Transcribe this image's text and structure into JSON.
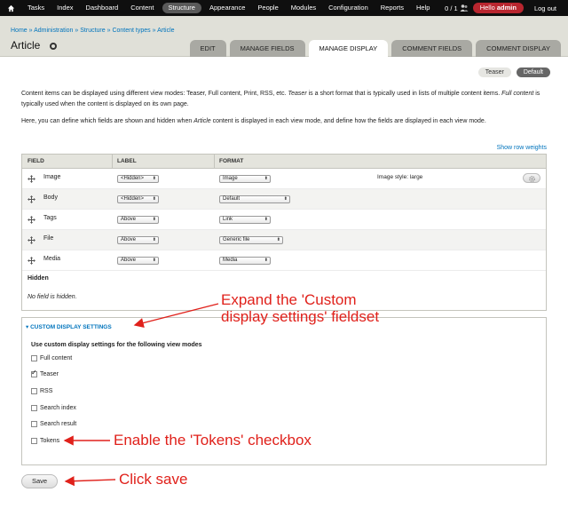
{
  "toolbar": {
    "items": [
      "Tasks",
      "Index",
      "Dashboard",
      "Content",
      "Structure",
      "Appearance",
      "People",
      "Modules",
      "Configuration",
      "Reports",
      "Help"
    ],
    "active": "Structure",
    "count": "0 / 1",
    "hello_prefix": "Hello ",
    "hello_user": "admin",
    "logout": "Log out"
  },
  "header": {
    "breadcrumb": [
      "Home",
      "Administration",
      "Structure",
      "Content types",
      "Article"
    ],
    "breadcrumb_sep": " » ",
    "title": "Article",
    "tabs": [
      "EDIT",
      "MANAGE FIELDS",
      "MANAGE DISPLAY",
      "COMMENT FIELDS",
      "COMMENT DISPLAY"
    ],
    "active_tab": "MANAGE DISPLAY"
  },
  "subtabs": [
    "Teaser",
    "Default"
  ],
  "active_subtab": "Default",
  "description": {
    "p1_a": "Content items can be displayed using different view modes: Teaser, Full content, Print, RSS, etc. ",
    "p1_teaser": "Teaser",
    "p1_b": " is a short format that is typically used in lists of multiple content items. ",
    "p1_full": "Full content",
    "p1_c": " is typically used when the content is displayed on its own page.",
    "p2_a": "Here, you can define which fields are shown and hidden when ",
    "p2_article": "Article",
    "p2_b": " content is displayed in each view mode, and define how the fields are displayed in each view mode."
  },
  "show_row_weights": "Show row weights",
  "table": {
    "headers": [
      "FIELD",
      "LABEL",
      "FORMAT"
    ],
    "rows": [
      {
        "field": "Image",
        "label": "<Hidden>",
        "format": "Image",
        "note": "Image style: large"
      },
      {
        "field": "Body",
        "label": "<Hidden>",
        "format": "Default",
        "note": ""
      },
      {
        "field": "Tags",
        "label": "Above",
        "format": "Link",
        "note": ""
      },
      {
        "field": "File",
        "label": "Above",
        "format": "Generic file",
        "note": ""
      },
      {
        "field": "Media",
        "label": "Above",
        "format": "Media",
        "note": ""
      }
    ],
    "hidden_label": "Hidden",
    "no_hidden": "No field is hidden."
  },
  "custom_settings": {
    "legend": "CUSTOM DISPLAY SETTINGS",
    "title": "Use custom display settings for the following view modes",
    "options": [
      {
        "label": "Full content",
        "checked": false
      },
      {
        "label": "Teaser",
        "checked": true
      },
      {
        "label": "RSS",
        "checked": false
      },
      {
        "label": "Search index",
        "checked": false
      },
      {
        "label": "Search result",
        "checked": false
      },
      {
        "label": "Tokens",
        "checked": false
      }
    ]
  },
  "save_label": "Save",
  "annotations": {
    "expand_1": "Expand the 'Custom",
    "expand_2": "display settings' fieldset",
    "tokens": "Enable the 'Tokens' checkbox",
    "save": "Click save"
  },
  "colors": {
    "link": "#0074bd",
    "annotation": "#e0211b",
    "hello": "#b8262f"
  }
}
